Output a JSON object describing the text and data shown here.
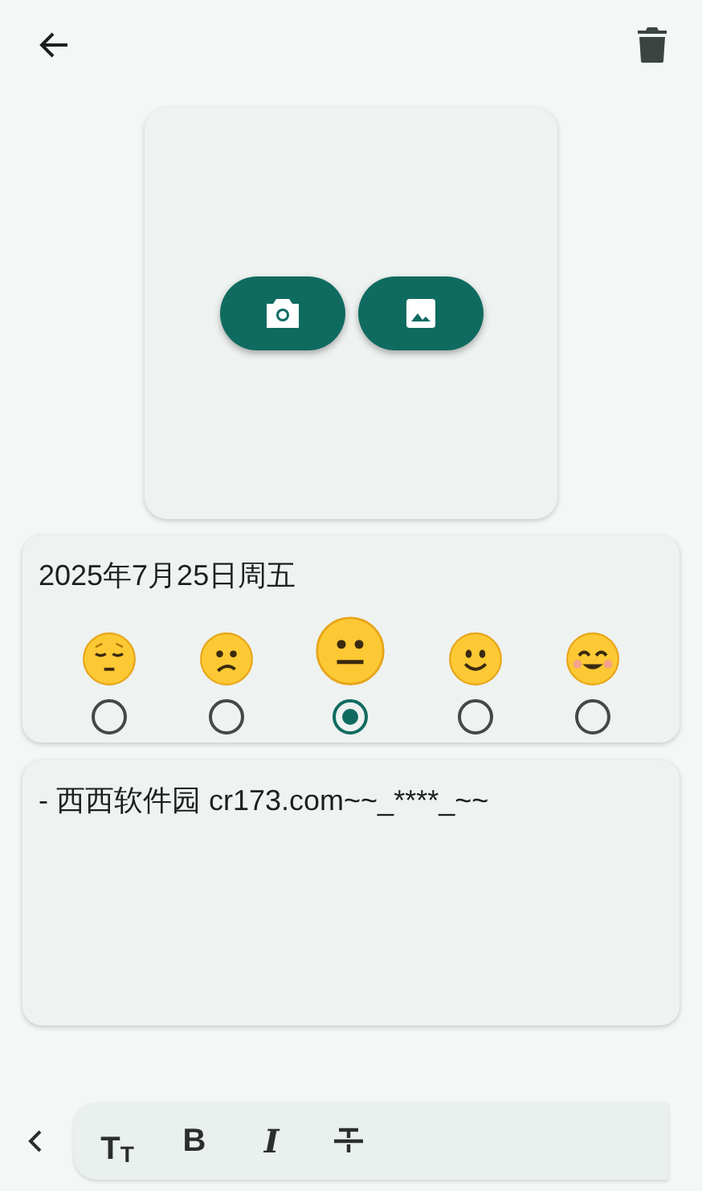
{
  "date": "2025年7月25日周五",
  "moods": [
    {
      "kind": "pensive",
      "selected": false
    },
    {
      "kind": "confused",
      "selected": false
    },
    {
      "kind": "neutral",
      "selected": true
    },
    {
      "kind": "smile",
      "selected": false
    },
    {
      "kind": "blush",
      "selected": false
    }
  ],
  "note": {
    "value": "- 西西软件园 cr173.com~~_****_~~"
  },
  "toolbar": [
    {
      "kind": "size",
      "label": "TT"
    },
    {
      "kind": "bold",
      "label": "B"
    },
    {
      "kind": "italic",
      "label": "I"
    },
    {
      "kind": "strike"
    }
  ]
}
